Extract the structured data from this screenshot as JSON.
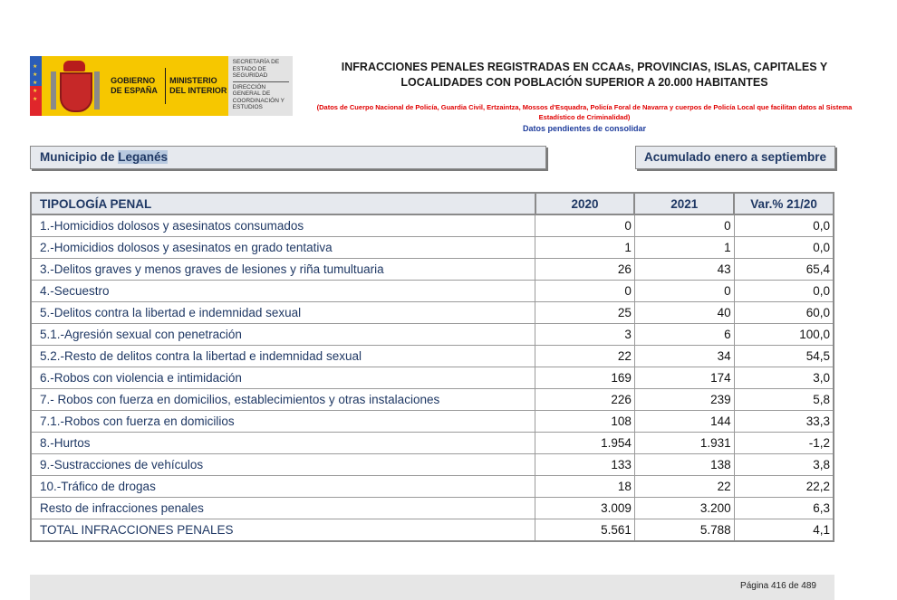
{
  "logo": {
    "gobierno": "GOBIERNO DE ESPAÑA",
    "ministerio": "MINISTERIO DEL INTERIOR",
    "secretaria": "SECRETARÍA DE ESTADO DE SEGURIDAD",
    "direccion": "DIRECCIÓN GENERAL DE COORDINACIÓN Y ESTUDIOS"
  },
  "header": {
    "title": "INFRACCIONES PENALES REGISTRADAS EN CCAAs, PROVINCIAS, ISLAS, CAPITALES Y LOCALIDADES CON POBLACIÓN SUPERIOR A 20.000 HABITANTES",
    "note": "(Datos de Cuerpo Nacional de Policía, Guardia Civil, Ertzaintza, Mossos d'Esquadra, Policía Foral de Navarra y cuerpos de Policía Local que facilitan datos al Sistema Estadístico de Criminalidad)",
    "pending": "Datos pendientes de consolidar"
  },
  "municipio": {
    "prefix": "Municipio de ",
    "name": "Leganés"
  },
  "periodo": "Acumulado enero a septiembre",
  "table": {
    "headers": [
      "TIPOLOGÍA PENAL",
      "2020",
      "2021",
      "Var.% 21/20"
    ],
    "rows": [
      [
        "1.-Homicidios dolosos y asesinatos consumados",
        "0",
        "0",
        "0,0"
      ],
      [
        "2.-Homicidios dolosos y asesinatos en grado tentativa",
        "1",
        "1",
        "0,0"
      ],
      [
        "3.-Delitos graves y menos graves de lesiones y riña tumultuaria",
        "26",
        "43",
        "65,4"
      ],
      [
        "4.-Secuestro",
        "0",
        "0",
        "0,0"
      ],
      [
        "5.-Delitos contra la libertad e indemnidad sexual",
        "25",
        "40",
        "60,0"
      ],
      [
        "5.1.-Agresión sexual con penetración",
        "3",
        "6",
        "100,0"
      ],
      [
        "5.2.-Resto de delitos contra la libertad e indemnidad sexual",
        "22",
        "34",
        "54,5"
      ],
      [
        "6.-Robos con violencia e intimidación",
        "169",
        "174",
        "3,0"
      ],
      [
        "7.- Robos con fuerza en domicilios, establecimientos y otras instalaciones",
        "226",
        "239",
        "5,8"
      ],
      [
        "7.1.-Robos con fuerza en domicilios",
        "108",
        "144",
        "33,3"
      ],
      [
        "8.-Hurtos",
        "1.954",
        "1.931",
        "-1,2"
      ],
      [
        "9.-Sustracciones de vehículos",
        "133",
        "138",
        "3,8"
      ],
      [
        "10.-Tráfico de drogas",
        "18",
        "22",
        "22,2"
      ],
      [
        "Resto de infracciones penales",
        "3.009",
        "3.200",
        "6,3"
      ],
      [
        "TOTAL INFRACCIONES PENALES",
        "5.561",
        "5.788",
        "4,1"
      ]
    ]
  },
  "footer": {
    "page": "Página 416 de 489"
  }
}
